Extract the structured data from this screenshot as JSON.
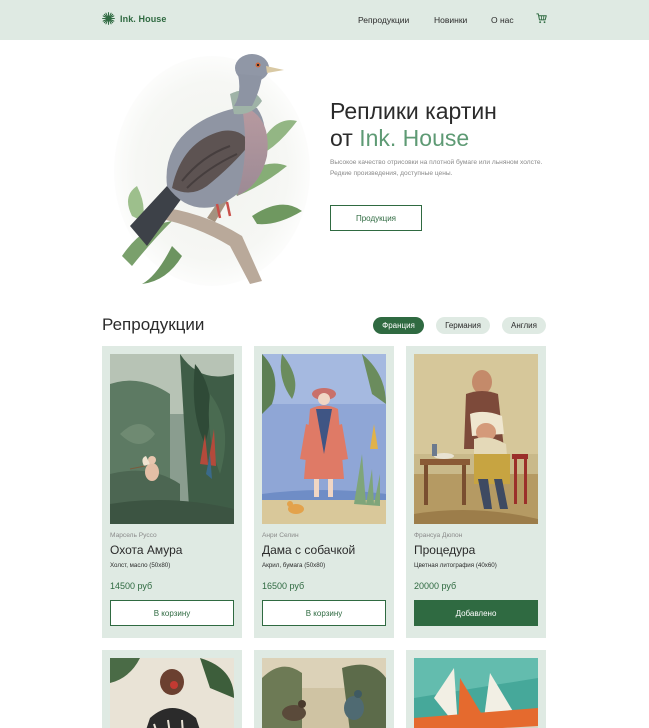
{
  "header": {
    "logo_text": "Ink. House",
    "logo_icon": "starburst-icon",
    "nav": [
      "Репродукции",
      "Новинки",
      "О нас"
    ],
    "cart_icon": "cart-icon"
  },
  "hero": {
    "title_line1": "Реплики картин",
    "title_prefix": "от ",
    "title_accent": "Ink. House",
    "subtitle": "Высокое качество отрисовки на плотной бумаге или льняном холсте. Редкие произведения, доступные цены.",
    "button_label": "Продукция",
    "image": "pigeon-illustration"
  },
  "catalog": {
    "title": "Репродукции",
    "filters": [
      {
        "label": "Франция",
        "active": true
      },
      {
        "label": "Германия",
        "active": false
      },
      {
        "label": "Англия",
        "active": false
      }
    ],
    "products": [
      {
        "author": "Марсель Руссо",
        "title": "Охота Амура",
        "material": "Холст, масло (50х80)",
        "price": "14500 руб",
        "button": "В корзину",
        "added": false,
        "image": "jungle-cupid-painting"
      },
      {
        "author": "Анри Селин",
        "title": "Дама с собачкой",
        "material": "Акрил, бумага (50х80)",
        "price": "16500 руб",
        "button": "В корзину",
        "added": false,
        "image": "lady-with-dog-painting"
      },
      {
        "author": "Франсуа Дюпон",
        "title": "Процедура",
        "material": "Цветная литография (40х60)",
        "price": "20000 руб",
        "button": "Добавлено",
        "added": true,
        "image": "procedure-lithograph"
      }
    ],
    "next_row_images": [
      "woman-portrait-painting",
      "birds-landscape-painting",
      "abstract-sail-print"
    ]
  },
  "colors": {
    "accent": "#2f6a41",
    "accent_light": "#5e9a74",
    "panel": "#dfeae3",
    "text": "#2b2b2b",
    "muted": "#8a8a8a"
  }
}
